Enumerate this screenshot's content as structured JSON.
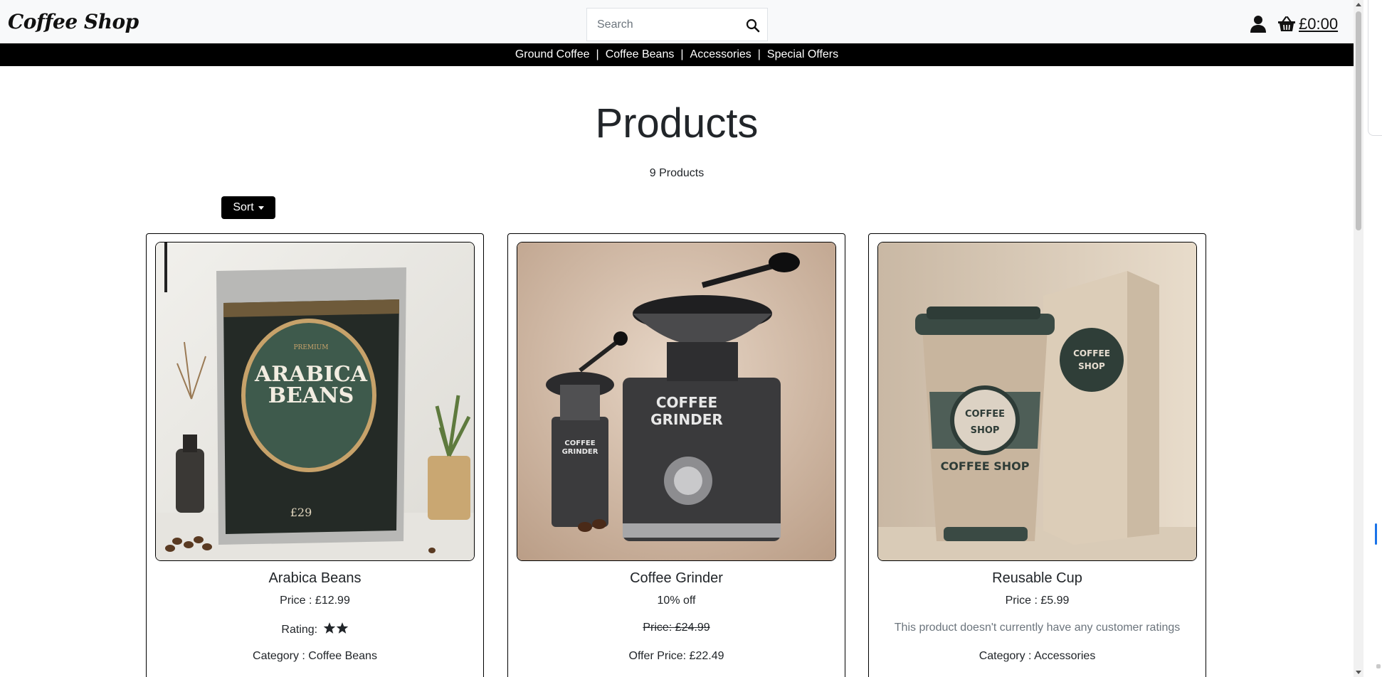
{
  "header": {
    "brand": "Coffee Shop",
    "search_placeholder": "Search",
    "cart_total": "£0:00",
    "icons": {
      "search": "search-icon",
      "user": "user-icon",
      "cart": "basket-icon"
    }
  },
  "nav": {
    "items": [
      {
        "label": "Ground Coffee"
      },
      {
        "label": "Coffee Beans"
      },
      {
        "label": "Accessories"
      },
      {
        "label": "Special Offers"
      }
    ],
    "separator": "|"
  },
  "main": {
    "title": "Products",
    "count": "9 Products",
    "sort_label": "Sort"
  },
  "products": [
    {
      "name": "Arabica Beans",
      "price": "Price : £12.99",
      "rating_label": "Rating:",
      "rating_stars": 2,
      "category": "Category : Coffee Beans",
      "image": "coffee-bag-image",
      "package_text": [
        "PREMIUM",
        "ARABICA",
        "BEANS",
        "£29"
      ]
    },
    {
      "name": "Coffee Grinder",
      "discount": "10% off",
      "old_price": "Price: £24.99",
      "offer_price": "Offer Price: £22.49",
      "image": "coffee-grinder-image",
      "package_text": [
        "COFFEE",
        "GRINDER"
      ]
    },
    {
      "name": "Reusable Cup",
      "price": "Price : £5.99",
      "no_rating": "This product doesn't currently have any customer ratings",
      "category": "Category : Accessories",
      "image": "reusable-cup-image",
      "package_text": [
        "COFFEE",
        "SHOP",
        "COFFEE SHOP"
      ]
    }
  ],
  "colors": {
    "navbar_bg": "#000000",
    "header_bg": "#f8f9fa",
    "text": "#212529",
    "muted": "#6c757d"
  }
}
